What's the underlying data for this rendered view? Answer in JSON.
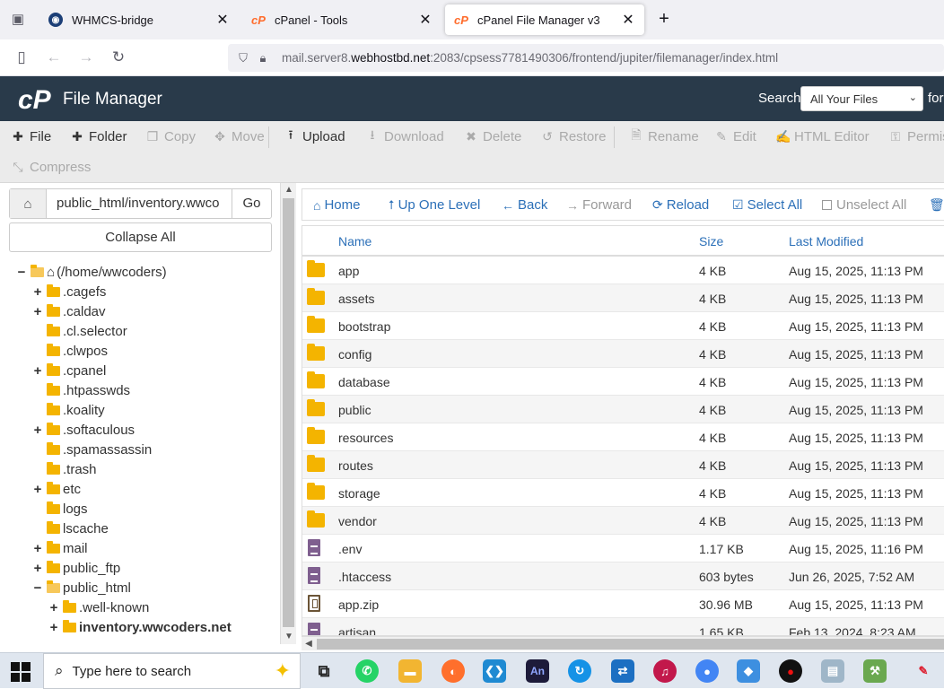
{
  "browser": {
    "tabs": [
      {
        "label": "WHMCS-bridge",
        "active": false
      },
      {
        "label": "cPanel - Tools",
        "active": false
      },
      {
        "label": "cPanel File Manager v3",
        "active": true
      }
    ],
    "url_prefix": "mail.server8.",
    "url_domain": "webhostbd.net",
    "url_suffix": ":2083/cpsess7781490306/frontend/jupiter/filemanager/index.html"
  },
  "header": {
    "title": "File Manager",
    "search_label": "Search",
    "search_scope": "All Your Files",
    "for_label": "for"
  },
  "toolbar": {
    "items": [
      {
        "label": "File",
        "enabled": true
      },
      {
        "label": "Folder",
        "enabled": true
      },
      {
        "label": "Copy",
        "enabled": false
      },
      {
        "label": "Move",
        "enabled": false
      },
      {
        "label": "Upload",
        "enabled": true
      },
      {
        "label": "Download",
        "enabled": false
      },
      {
        "label": "Delete",
        "enabled": false
      },
      {
        "label": "Restore",
        "enabled": false
      },
      {
        "label": "Rename",
        "enabled": false
      },
      {
        "label": "Edit",
        "enabled": false
      },
      {
        "label": "HTML Editor",
        "enabled": false
      },
      {
        "label": "Permis",
        "enabled": false
      },
      {
        "label": "Compress",
        "enabled": false
      }
    ]
  },
  "left": {
    "path_value": "public_html/inventory.wwco",
    "go_label": "Go",
    "collapse_label": "Collapse All",
    "tree": [
      {
        "label": "(/home/wwcoders)",
        "toggle": "−",
        "depth": 0,
        "home": true
      },
      {
        "label": ".cagefs",
        "toggle": "+",
        "depth": 1
      },
      {
        "label": ".caldav",
        "toggle": "+",
        "depth": 1
      },
      {
        "label": ".cl.selector",
        "toggle": "",
        "depth": 1
      },
      {
        "label": ".clwpos",
        "toggle": "",
        "depth": 1
      },
      {
        "label": ".cpanel",
        "toggle": "+",
        "depth": 1
      },
      {
        "label": ".htpasswds",
        "toggle": "",
        "depth": 1
      },
      {
        "label": ".koality",
        "toggle": "",
        "depth": 1
      },
      {
        "label": ".softaculous",
        "toggle": "+",
        "depth": 1
      },
      {
        "label": ".spamassassin",
        "toggle": "",
        "depth": 1
      },
      {
        "label": ".trash",
        "toggle": "",
        "depth": 1
      },
      {
        "label": "etc",
        "toggle": "+",
        "depth": 1
      },
      {
        "label": "logs",
        "toggle": "",
        "depth": 1
      },
      {
        "label": "lscache",
        "toggle": "",
        "depth": 1
      },
      {
        "label": "mail",
        "toggle": "+",
        "depth": 1
      },
      {
        "label": "public_ftp",
        "toggle": "+",
        "depth": 1
      },
      {
        "label": "public_html",
        "toggle": "−",
        "depth": 1,
        "open": true
      },
      {
        "label": ".well-known",
        "toggle": "+",
        "depth": 2
      },
      {
        "label": "inventory.wwcoders.net",
        "toggle": "+",
        "depth": 2,
        "bold": true
      }
    ]
  },
  "rightnav": {
    "home": "Home",
    "up": "Up One Level",
    "back": "Back",
    "forward": "Forward",
    "reload": "Reload",
    "select_all": "Select All",
    "unselect_all": "Unselect All"
  },
  "table": {
    "headers": {
      "name": "Name",
      "size": "Size",
      "modified": "Last Modified"
    },
    "rows": [
      {
        "name": "app",
        "size": "4 KB",
        "modified": "Aug 15, 2025, 11:13 PM",
        "type": "folder"
      },
      {
        "name": "assets",
        "size": "4 KB",
        "modified": "Aug 15, 2025, 11:13 PM",
        "type": "folder"
      },
      {
        "name": "bootstrap",
        "size": "4 KB",
        "modified": "Aug 15, 2025, 11:13 PM",
        "type": "folder"
      },
      {
        "name": "config",
        "size": "4 KB",
        "modified": "Aug 15, 2025, 11:13 PM",
        "type": "folder"
      },
      {
        "name": "database",
        "size": "4 KB",
        "modified": "Aug 15, 2025, 11:13 PM",
        "type": "folder"
      },
      {
        "name": "public",
        "size": "4 KB",
        "modified": "Aug 15, 2025, 11:13 PM",
        "type": "folder"
      },
      {
        "name": "resources",
        "size": "4 KB",
        "modified": "Aug 15, 2025, 11:13 PM",
        "type": "folder"
      },
      {
        "name": "routes",
        "size": "4 KB",
        "modified": "Aug 15, 2025, 11:13 PM",
        "type": "folder"
      },
      {
        "name": "storage",
        "size": "4 KB",
        "modified": "Aug 15, 2025, 11:13 PM",
        "type": "folder"
      },
      {
        "name": "vendor",
        "size": "4 KB",
        "modified": "Aug 15, 2025, 11:13 PM",
        "type": "folder"
      },
      {
        "name": ".env",
        "size": "1.17 KB",
        "modified": "Aug 15, 2025, 11:16 PM",
        "type": "file"
      },
      {
        "name": ".htaccess",
        "size": "603 bytes",
        "modified": "Jun 26, 2025, 7:52 AM",
        "type": "file"
      },
      {
        "name": "app.zip",
        "size": "30.96 MB",
        "modified": "Aug 15, 2025, 11:13 PM",
        "type": "zip"
      },
      {
        "name": "artisan",
        "size": "1.65 KB",
        "modified": "Feb 13, 2024, 8:23 AM",
        "type": "file"
      }
    ]
  },
  "taskbar": {
    "search_placeholder": "Type here to search"
  }
}
